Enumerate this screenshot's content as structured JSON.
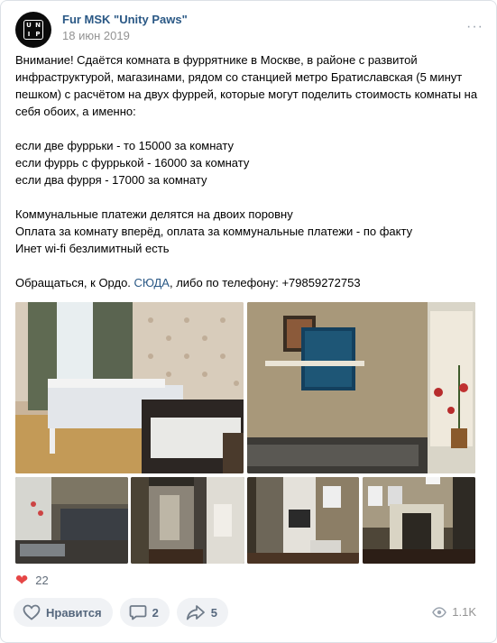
{
  "post": {
    "author": "Fur MSK \"Unity Paws\"",
    "avatar_letters": [
      "U",
      "N",
      "I",
      "P"
    ],
    "date": "18 июн 2019",
    "more": "···",
    "body_paragraph_1": "Внимание! Сдаётся комната в фуррятнике в Москве, в районе с развитой инфраструктурой, магазинами, рядом со станцией метро Братиславская (5 минут пешком) с расчётом на двух фуррей, которые могут поделить стоимость комнаты на себя обоих, а именно:",
    "body_paragraph_2": "если две фуррьки - то 15000 за комнату\nесли фуррь с фуррькой - 16000 за комнату\nесли два фурря - 17000 за комнату",
    "body_paragraph_3": "Коммунальные платежи делятся на двоих поровну\nОплата за комнату вперёд, оплата за коммунальные платежи - по факту\nИнет wi-fi безлимитный есть",
    "contact_prefix": "Обращаться, к Ордо. ",
    "contact_link": "СЮДА",
    "contact_suffix": ", либо по телефону: +79859272753"
  },
  "photos": [
    {
      "name": "photo-bedroom"
    },
    {
      "name": "photo-room-corner"
    },
    {
      "name": "photo-kitchen"
    },
    {
      "name": "photo-hallway"
    },
    {
      "name": "photo-doorway"
    },
    {
      "name": "photo-corridor-mirror"
    },
    {
      "name": "photo-corridor"
    }
  ],
  "reactions": {
    "heart_icon": "heart-icon",
    "likes": "22"
  },
  "actions": {
    "like_label": "Нравится",
    "comments": "2",
    "shares": "5"
  },
  "views": "1.1K",
  "colors": {
    "link": "#2a5885",
    "heart": "#e64646",
    "button_bg": "#f0f2f5",
    "muted": "#939393"
  }
}
